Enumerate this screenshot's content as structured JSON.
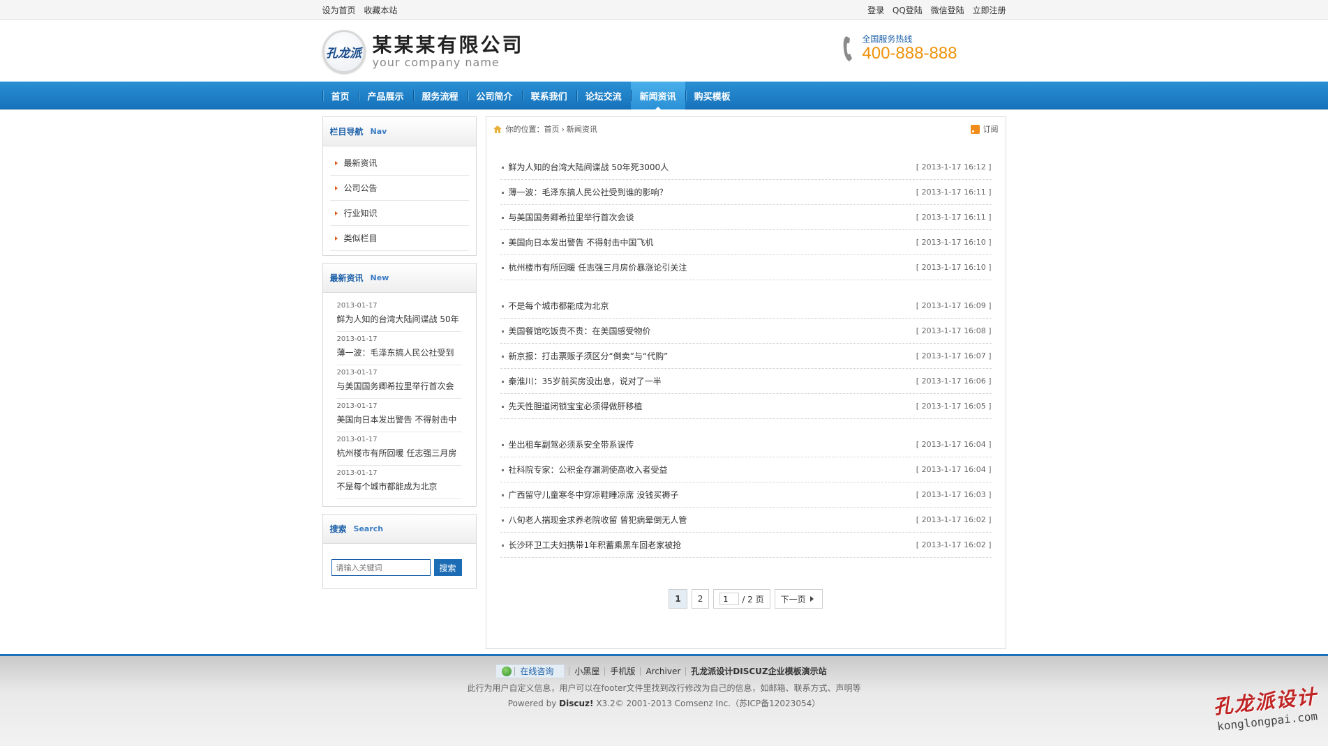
{
  "topbar": {
    "left": [
      "设为首页",
      "收藏本站"
    ],
    "right": [
      "登录",
      "QQ登陆",
      "微信登陆",
      "立即注册"
    ]
  },
  "header": {
    "logo_mark": "孔龙派",
    "company_cn": "某某某有限公司",
    "company_en": "your company name",
    "hotline_label": "全国服务热线",
    "hotline_number": "400-888-888"
  },
  "nav": {
    "items": [
      "首页",
      "产品展示",
      "服务流程",
      "公司简介",
      "联系我们",
      "论坛交流",
      "新闻资讯",
      "购买模板"
    ],
    "active_index": 6
  },
  "sidebar": {
    "nav_box": {
      "title": "栏目导航",
      "title_en": "Nav",
      "items": [
        "最新资讯",
        "公司公告",
        "行业知识",
        "类似栏目"
      ]
    },
    "news_box": {
      "title": "最新资讯",
      "title_en": "New",
      "items": [
        {
          "date": "2013-01-17",
          "title": "鲜为人知的台湾大陆间谍战 50年"
        },
        {
          "date": "2013-01-17",
          "title": "薄一波：毛泽东搞人民公社受到"
        },
        {
          "date": "2013-01-17",
          "title": "与美国国务卿希拉里举行首次会"
        },
        {
          "date": "2013-01-17",
          "title": "美国向日本发出警告 不得射击中"
        },
        {
          "date": "2013-01-17",
          "title": "杭州楼市有所回暖 任志强三月房"
        },
        {
          "date": "2013-01-17",
          "title": "不是每个城市都能成为北京"
        }
      ]
    },
    "search_box": {
      "title": "搜索",
      "title_en": "Search",
      "placeholder": "请输入关键词",
      "button": "搜索"
    }
  },
  "content": {
    "breadcrumb": {
      "prefix": "你的位置：",
      "home": "首页",
      "sep": "›",
      "current": "新闻资讯"
    },
    "rss": "订阅",
    "groups": [
      [
        {
          "title": "鲜为人知的台湾大陆间谍战 50年死3000人",
          "date": "[ 2013-1-17 16:12 ]"
        },
        {
          "title": "薄一波：毛泽东搞人民公社受到谁的影响？",
          "date": "[ 2013-1-17 16:11 ]"
        },
        {
          "title": "与美国国务卿希拉里举行首次会谈",
          "date": "[ 2013-1-17 16:11 ]"
        },
        {
          "title": "美国向日本发出警告 不得射击中国飞机",
          "date": "[ 2013-1-17 16:10 ]"
        },
        {
          "title": "杭州楼市有所回暖 任志强三月房价暴涨论引关注",
          "date": "[ 2013-1-17 16:10 ]"
        }
      ],
      [
        {
          "title": "不是每个城市都能成为北京",
          "date": "[ 2013-1-17 16:09 ]"
        },
        {
          "title": "美国餐馆吃饭贵不贵：在美国感受物价",
          "date": "[ 2013-1-17 16:08 ]"
        },
        {
          "title": "新京报：打击票贩子须区分“倒卖”与“代购”",
          "date": "[ 2013-1-17 16:07 ]"
        },
        {
          "title": "秦淮川：35岁前买房没出息，说对了一半",
          "date": "[ 2013-1-17 16:06 ]"
        },
        {
          "title": "先天性胆道闭锁宝宝必须得做肝移植",
          "date": "[ 2013-1-17 16:05 ]"
        }
      ],
      [
        {
          "title": "坐出租车副驾必须系安全带系误传",
          "date": "[ 2013-1-17 16:04 ]"
        },
        {
          "title": "社科院专家：公积金存漏洞使高收入者受益",
          "date": "[ 2013-1-17 16:04 ]"
        },
        {
          "title": "广西留守儿童寒冬中穿凉鞋睡凉席 没钱买褥子",
          "date": "[ 2013-1-17 16:03 ]"
        },
        {
          "title": "八旬老人揣现金求养老院收留 曾犯病晕倒无人管",
          "date": "[ 2013-1-17 16:02 ]"
        },
        {
          "title": "长沙环卫工夫妇携带1年积蓄乘黑车回老家被抢",
          "date": "[ 2013-1-17 16:02 ]"
        }
      ]
    ],
    "pager": {
      "page1": "1",
      "page2": "2",
      "input_value": "1",
      "total": "/ 2 页",
      "next": "下一页"
    }
  },
  "footer": {
    "consult": "在线咨询",
    "links": [
      "小黑屋",
      "手机版",
      "Archiver"
    ],
    "site": "孔龙派设计DISCUZ企业模板演示站",
    "note": "此行为用户自定义信息，用户可以在footer文件里找到改行修改为自己的信息，如邮箱、联系方式、声明等",
    "powered_prefix": "Powered by",
    "powered_name": "Discuz!",
    "powered_rest": "X3.2© 2001-2013 Comsenz Inc.（苏ICP备12023054）"
  },
  "watermark": {
    "cn": "孔龙派设计",
    "en": "konglongpai.com"
  },
  "colors": {
    "nav_blue": "#1673bb",
    "hotline_orange": "#f0920a",
    "link_blue": "#1b5fa8"
  }
}
